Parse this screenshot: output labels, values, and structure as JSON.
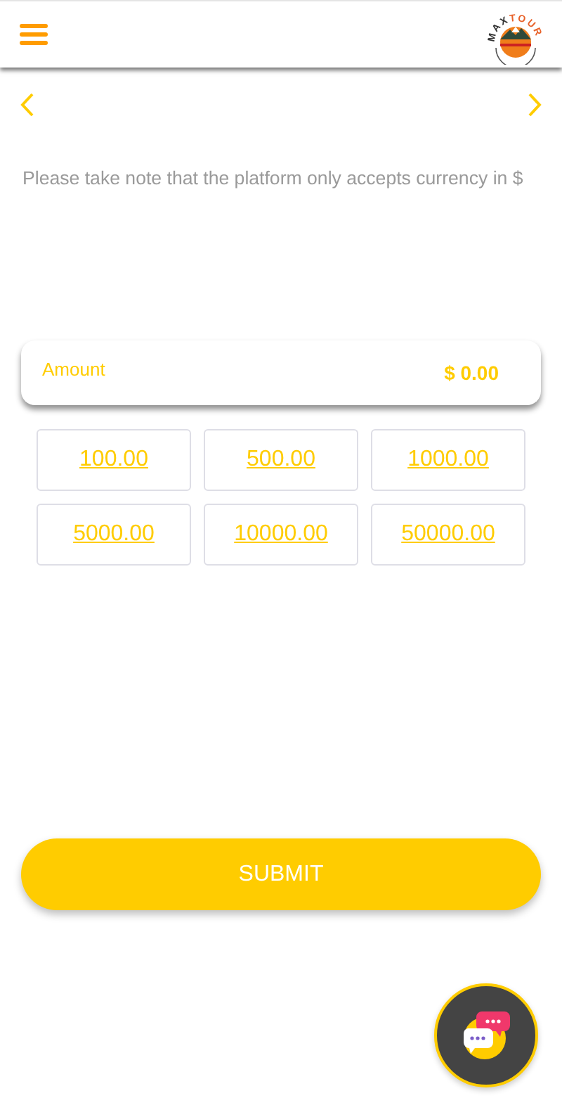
{
  "header": {
    "logo": {
      "part_1": "MAX",
      "part_2": "TOUR"
    }
  },
  "notice": "Please take note that the platform only accepts currency in $",
  "amount": {
    "label": "Amount",
    "value": "$ 0.00"
  },
  "presets": [
    {
      "label": "100.00"
    },
    {
      "label": "500.00"
    },
    {
      "label": "1000.00"
    },
    {
      "label": "5000.00"
    },
    {
      "label": "10000.00"
    },
    {
      "label": "50000.00"
    }
  ],
  "submit": "SUBMIT"
}
